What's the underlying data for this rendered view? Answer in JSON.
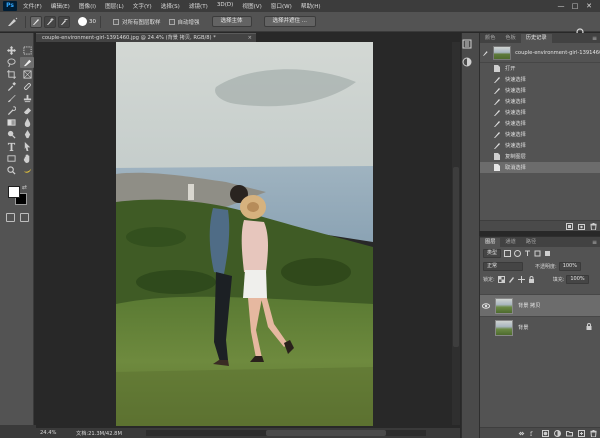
{
  "app": {
    "logo": "Ps"
  },
  "menubar": {
    "items": [
      "文件(F)",
      "编辑(E)",
      "图像(I)",
      "图层(L)",
      "文字(Y)",
      "选择(S)",
      "滤镜(T)",
      "3D(D)",
      "视图(V)",
      "窗口(W)",
      "帮助(H)"
    ],
    "window_controls": [
      "—",
      "□",
      "✕"
    ]
  },
  "options": {
    "brush_size": "30",
    "sample_all_layers": "对所有图层取样",
    "auto_enhance": "自动增强",
    "select_subject": "选择主体",
    "select_and_mask": "选择并遮住 ..."
  },
  "document": {
    "tab_title": "couple-environment-girl-1391460.jpg @ 24.4% (背景 拷贝, RGB/8) *",
    "tab_close": "×"
  },
  "status": {
    "zoom": "24.4%",
    "doc_size": "文档:21.3M/42.8M"
  },
  "history": {
    "tabs": [
      "颜色",
      "色板",
      "历史记录"
    ],
    "active_tab": "历史记录",
    "menu": "≡",
    "snapshot_name": "couple-environment-girl-1391460...",
    "items": [
      {
        "label": "打开",
        "icon": "doc-icon",
        "checked": false
      },
      {
        "label": "快速选择",
        "icon": "brush-icon",
        "checked": false
      },
      {
        "label": "快速选择",
        "icon": "brush-icon",
        "checked": false
      },
      {
        "label": "快速选择",
        "icon": "brush-icon",
        "checked": false
      },
      {
        "label": "快速选择",
        "icon": "brush-icon",
        "checked": false
      },
      {
        "label": "快速选择",
        "icon": "brush-icon",
        "checked": false
      },
      {
        "label": "快速选择",
        "icon": "brush-icon",
        "checked": false
      },
      {
        "label": "快速选择",
        "icon": "brush-icon",
        "checked": false
      },
      {
        "label": "复制图层",
        "icon": "doc-icon",
        "checked": false
      },
      {
        "label": "取消选择",
        "icon": "doc-icon",
        "checked": false
      }
    ],
    "selected_index": 9
  },
  "layers": {
    "tabs": [
      "图层",
      "通道",
      "路径"
    ],
    "active_tab": "图层",
    "menu": "≡",
    "filter_kind": "类型",
    "blend_mode": "正常",
    "opacity_label": "不透明度:",
    "opacity_value": "100%",
    "lock_label": "锁定:",
    "fill_label": "填充:",
    "fill_value": "100%",
    "rows": [
      {
        "name": "背景 拷贝",
        "selected": true,
        "locked": false
      },
      {
        "name": "背景",
        "selected": false,
        "locked": true
      }
    ]
  },
  "colors": {
    "foreground": "#ffffff",
    "background": "#000000",
    "ui_dark": "#282828",
    "ui_panel": "#535353"
  }
}
